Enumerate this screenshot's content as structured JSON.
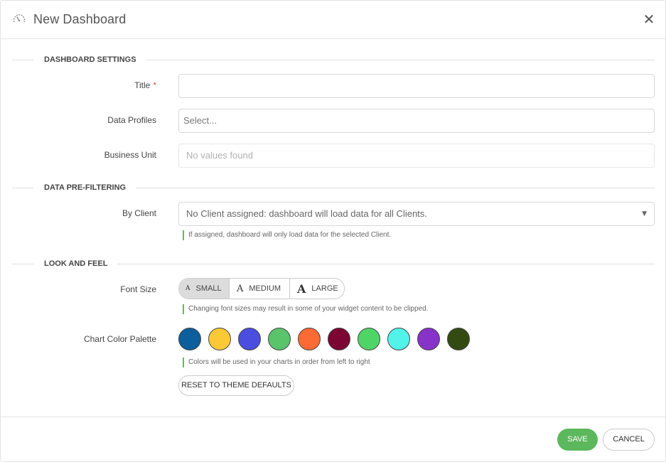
{
  "header": {
    "title": "New Dashboard",
    "icon": "gauge-icon"
  },
  "sections": {
    "dashboard_settings": "DASHBOARD SETTINGS",
    "data_pre_filtering": "DATA PRE-FILTERING",
    "look_and_feel": "LOOK AND FEEL"
  },
  "fields": {
    "title": {
      "label": "Title",
      "required_mark": "*",
      "value": ""
    },
    "data_profiles": {
      "label": "Data Profiles",
      "placeholder": "Select..."
    },
    "business_unit": {
      "label": "Business Unit",
      "placeholder": "No values found"
    },
    "by_client": {
      "label": "By Client",
      "value": "No Client assigned: dashboard will load data for all Clients.",
      "help": "If assigned, dashboard will only load data for the selected Client."
    },
    "font_size": {
      "label": "Font Size",
      "options": [
        "SMALL",
        "MEDIUM",
        "LARGE"
      ],
      "glyph": "A",
      "selected": "SMALL",
      "help": "Changing font sizes may result in some of your widget content to be clipped."
    },
    "chart_color_palette": {
      "label": "Chart Color Palette",
      "colors": [
        "#0c5e9c",
        "#fbc936",
        "#4a4de0",
        "#5ac46a",
        "#fd6a33",
        "#7d0533",
        "#4fd567",
        "#52f3e9",
        "#8732c8",
        "#334b11"
      ],
      "help": "Colors will be used in your charts in order from left to right",
      "reset_label": "RESET TO THEME DEFAULTS"
    }
  },
  "footer": {
    "save_label": "SAVE",
    "cancel_label": "CANCEL"
  },
  "theme": {
    "accent_green": "#5cb85c",
    "required_red": "#d9534f"
  }
}
